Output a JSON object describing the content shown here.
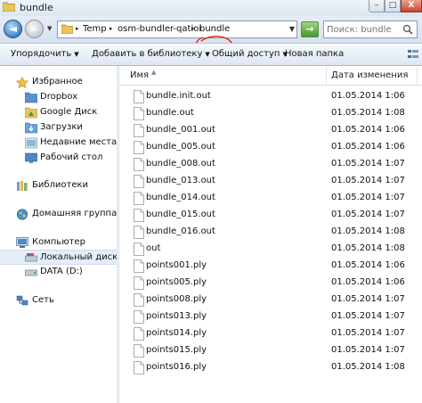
{
  "window": {
    "title": "bundle",
    "minimize_glyph": "–",
    "maximize_glyph": "□",
    "close_glyph": "X"
  },
  "nav": {
    "back_glyph": "◄",
    "forward_glyph": "►",
    "breadcrumb": [
      "Temp",
      "osm-bundler-qatioi",
      "bundle"
    ],
    "separator_glyph": "▸",
    "dropdown_glyph": "▼",
    "refresh_glyph": "→",
    "search_placeholder": "Поиск: bundle"
  },
  "toolbar": {
    "organize": "Упорядочить",
    "add_to_library": "Добавить в библиотеку",
    "share": "Общий доступ",
    "new_folder": "Новая папка",
    "arrow_glyph": "▼"
  },
  "sidebar": {
    "favorites": "Избранное",
    "dropbox": "Dropbox",
    "google_drive": "Google Диск",
    "downloads": "Загрузки",
    "recent_places": "Недавние места",
    "desktop": "Рабочий стол",
    "libraries": "Библиотеки",
    "homegroup": "Домашняя группа",
    "computer": "Компьютер",
    "local_disk": "Локальный диск (C",
    "data_disk": "DATA (D:)",
    "network": "Сеть"
  },
  "columns": {
    "name": "Имя",
    "sort_glyph": "▲",
    "date_modified": "Дата изменения"
  },
  "files": [
    {
      "name": "bundle.init.out",
      "date": "01.05.2014 1:06"
    },
    {
      "name": "bundle.out",
      "date": "01.05.2014 1:08"
    },
    {
      "name": "bundle_001.out",
      "date": "01.05.2014 1:06"
    },
    {
      "name": "bundle_005.out",
      "date": "01.05.2014 1:06"
    },
    {
      "name": "bundle_008.out",
      "date": "01.05.2014 1:07"
    },
    {
      "name": "bundle_013.out",
      "date": "01.05.2014 1:07"
    },
    {
      "name": "bundle_014.out",
      "date": "01.05.2014 1:07"
    },
    {
      "name": "bundle_015.out",
      "date": "01.05.2014 1:07"
    },
    {
      "name": "bundle_016.out",
      "date": "01.05.2014 1:08"
    },
    {
      "name": "out",
      "date": "01.05.2014 1:08"
    },
    {
      "name": "points001.ply",
      "date": "01.05.2014 1:06"
    },
    {
      "name": "points005.ply",
      "date": "01.05.2014 1:06"
    },
    {
      "name": "points008.ply",
      "date": "01.05.2014 1:07"
    },
    {
      "name": "points013.ply",
      "date": "01.05.2014 1:07"
    },
    {
      "name": "points014.ply",
      "date": "01.05.2014 1:07"
    },
    {
      "name": "points015.ply",
      "date": "01.05.2014 1:07"
    },
    {
      "name": "points016.ply",
      "date": "01.05.2014 1:08"
    }
  ],
  "colors": {
    "annotation_circle": "#e02020",
    "selection": "#e5eef8"
  }
}
